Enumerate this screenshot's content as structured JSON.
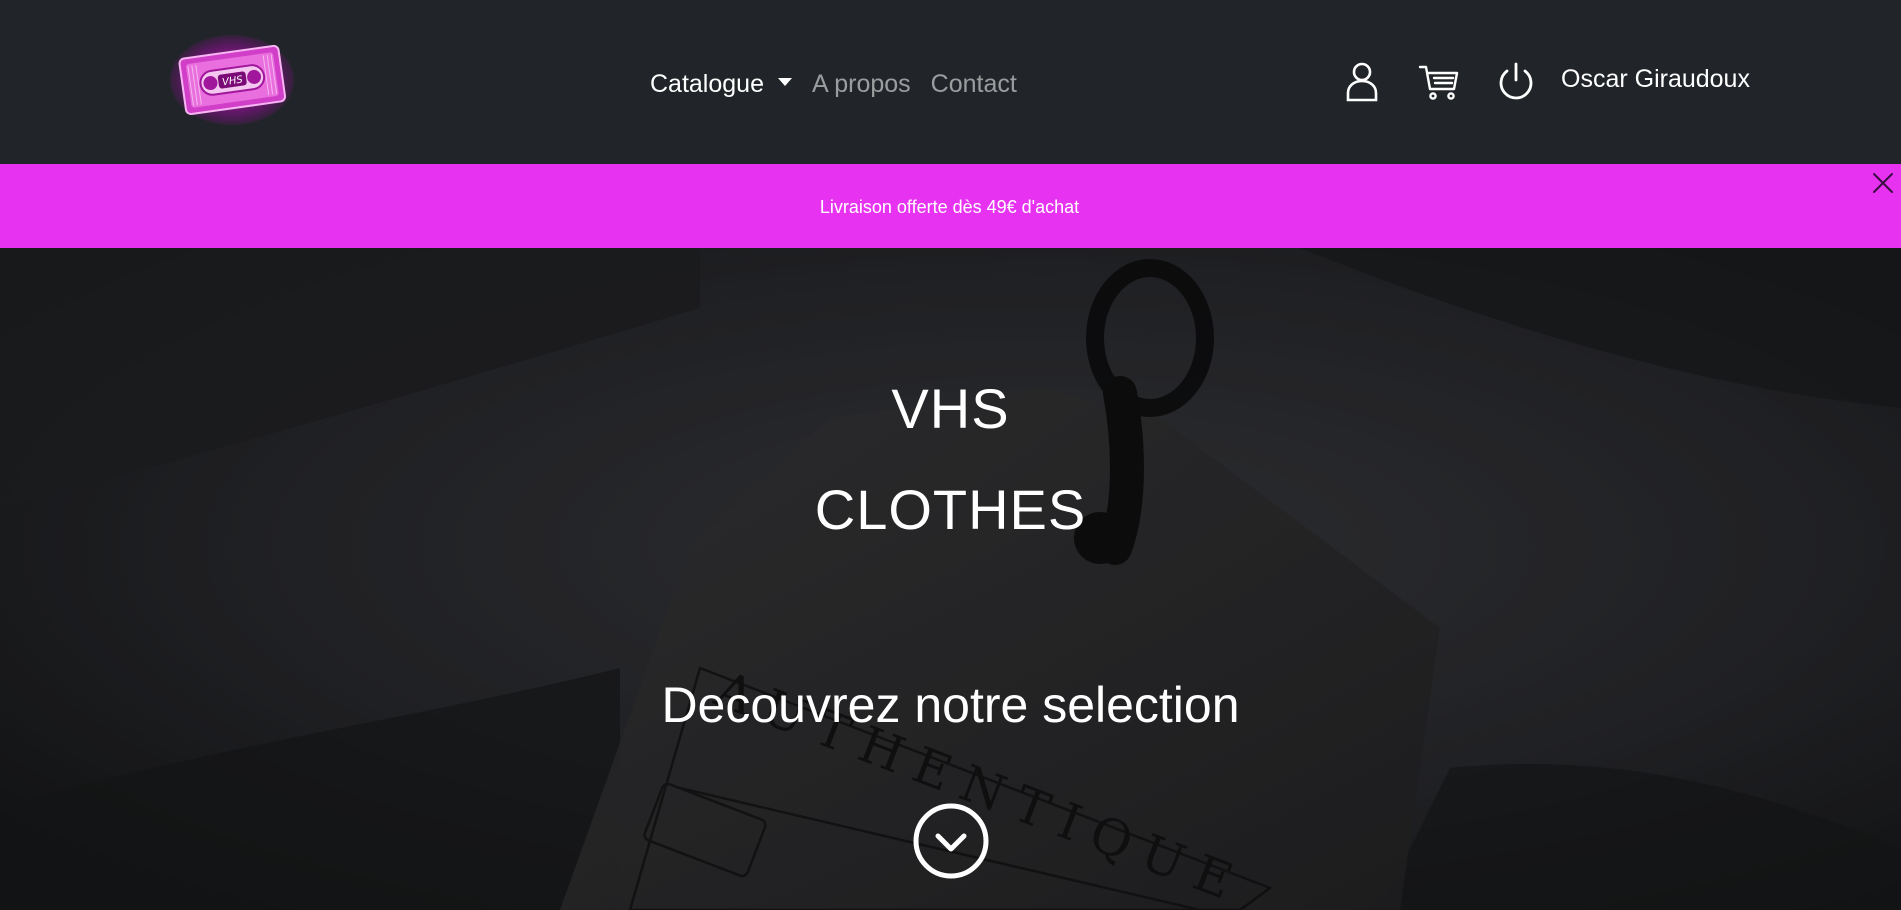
{
  "navbar": {
    "logo_text": "VHS",
    "links": [
      {
        "label": "Catalogue",
        "has_dropdown": true,
        "active": true
      },
      {
        "label": "A propos",
        "has_dropdown": false,
        "active": false
      },
      {
        "label": "Contact",
        "has_dropdown": false,
        "active": false
      }
    ],
    "icons": [
      "user-icon",
      "cart-icon",
      "power-icon"
    ],
    "user_name": "Oscar Giraudoux"
  },
  "promo": {
    "text": "Livraison offerte dès 49€ d'achat",
    "close_icon": "close-icon"
  },
  "hero": {
    "title_line1": "VHS",
    "title_line2": "CLOTHES",
    "subtitle": "Decouvrez notre selection",
    "scroll_icon": "chevron-down-circle-icon",
    "tag_text": "AUTHENTIQUE"
  },
  "colors": {
    "navbar_bg": "#212529",
    "promo_bg": "#e832f2",
    "accent": "#e832f2",
    "text": "#ffffff"
  }
}
